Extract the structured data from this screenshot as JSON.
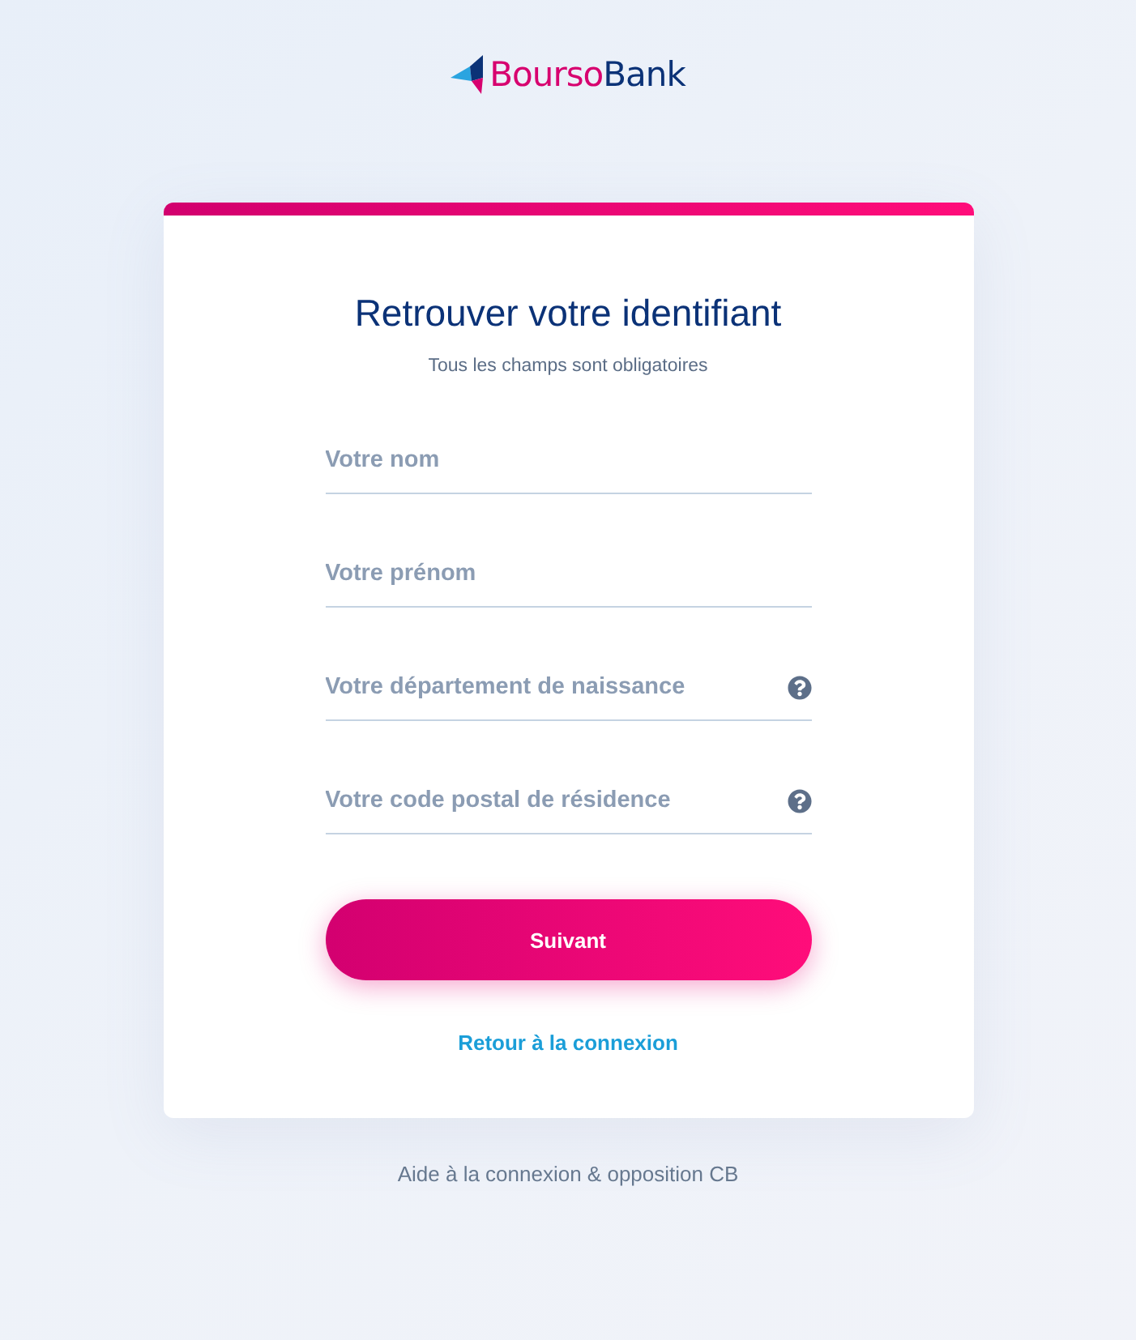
{
  "logo": {
    "parts": [
      {
        "text": "Bourso",
        "kind": "accent"
      },
      {
        "text": "Bank",
        "kind": "base"
      }
    ]
  },
  "card": {
    "title": "Retrouver votre identifiant",
    "subtitle": "Tous les champs sont obligatoires"
  },
  "fields": [
    {
      "placeholder": "Votre nom",
      "help": false
    },
    {
      "placeholder": "Votre prénom",
      "help": false
    },
    {
      "placeholder": "Votre département de naissance",
      "help": true
    },
    {
      "placeholder": "Votre code postal de résidence",
      "help": true
    }
  ],
  "submit_button": {
    "label": "Suivant"
  },
  "back_link": {
    "label": "Retour à la connexion"
  },
  "footer_link": {
    "label": "Aide à la connexion & opposition CB"
  }
}
